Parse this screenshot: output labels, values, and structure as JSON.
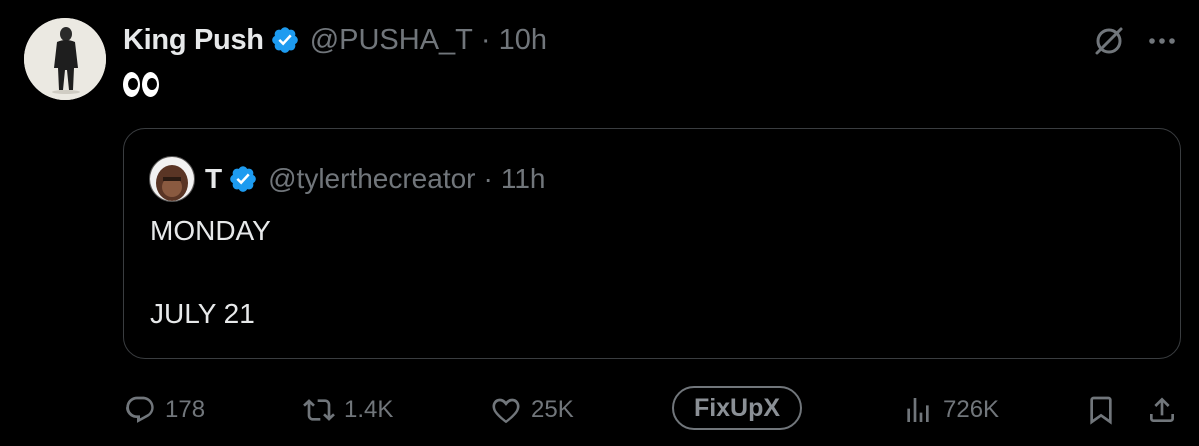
{
  "tweet": {
    "author_name": "King Push",
    "handle": "@PUSHA_T",
    "separator": "·",
    "time": "10h",
    "text_emoji": "eyes"
  },
  "quote": {
    "author_name": "T",
    "handle": "@tylerthecreator",
    "separator": "·",
    "time": "11h",
    "line1": "MONDAY",
    "line2": "JULY 21"
  },
  "actions": {
    "replies": "178",
    "reposts": "1.4K",
    "likes": "25K",
    "fixup_label": "FixUpX",
    "views": "726K"
  },
  "icons": {
    "header": [
      "grok-icon",
      "more-icon"
    ],
    "actions": [
      "reply-icon",
      "repost-icon",
      "like-icon",
      "views-icon",
      "bookmark-icon",
      "share-icon"
    ]
  },
  "colors": {
    "background": "#000000",
    "text": "#e7e9ea",
    "muted": "#71767b",
    "verified": "#1d9bf0",
    "quote_border": "#3a3d40"
  }
}
